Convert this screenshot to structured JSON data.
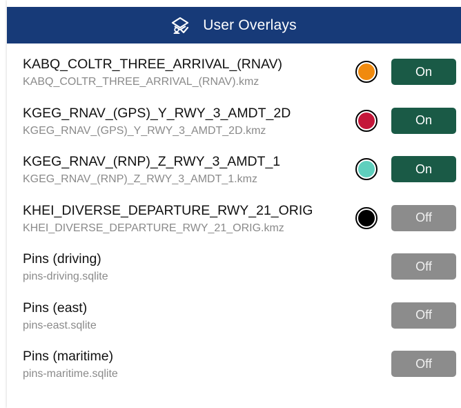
{
  "header": {
    "title": "User Overlays",
    "icon": "user-layers-icon",
    "background": "#173a78"
  },
  "overlays": [
    {
      "name": "KABQ_COLTR_THREE_ARRIVAL_(RNAV)",
      "file": "KABQ_COLTR_THREE_ARRIVAL_(RNAV).kmz",
      "color": "#f08a0e",
      "toggle": "On",
      "state": "on"
    },
    {
      "name": "KGEG_RNAV_(GPS)_Y_RWY_3_AMDT_2D",
      "file": "KGEG_RNAV_(GPS)_Y_RWY_3_AMDT_2D.kmz",
      "color": "#c4173a",
      "toggle": "On",
      "state": "on"
    },
    {
      "name": "KGEG_RNAV_(RNP)_Z_RWY_3_AMDT_1",
      "file": "KGEG_RNAV_(RNP)_Z_RWY_3_AMDT_1.kmz",
      "color": "#5fcfbd",
      "toggle": "On",
      "state": "on"
    },
    {
      "name": "KHEI_DIVERSE_DEPARTURE_RWY_21_ORIG",
      "file": "KHEI_DIVERSE_DEPARTURE_RWY_21_ORIG.kmz",
      "color": "#000000",
      "toggle": "Off",
      "state": "off"
    },
    {
      "name": "Pins (driving)",
      "file": "pins-driving.sqlite",
      "color": null,
      "toggle": "Off",
      "state": "off"
    },
    {
      "name": "Pins (east)",
      "file": "pins-east.sqlite",
      "color": null,
      "toggle": "Off",
      "state": "off"
    },
    {
      "name": "Pins (maritime)",
      "file": "pins-maritime.sqlite",
      "color": null,
      "toggle": "Off",
      "state": "off"
    }
  ],
  "colors": {
    "toggle_on": "#1a5a46",
    "toggle_off": "#8c8c8c"
  }
}
